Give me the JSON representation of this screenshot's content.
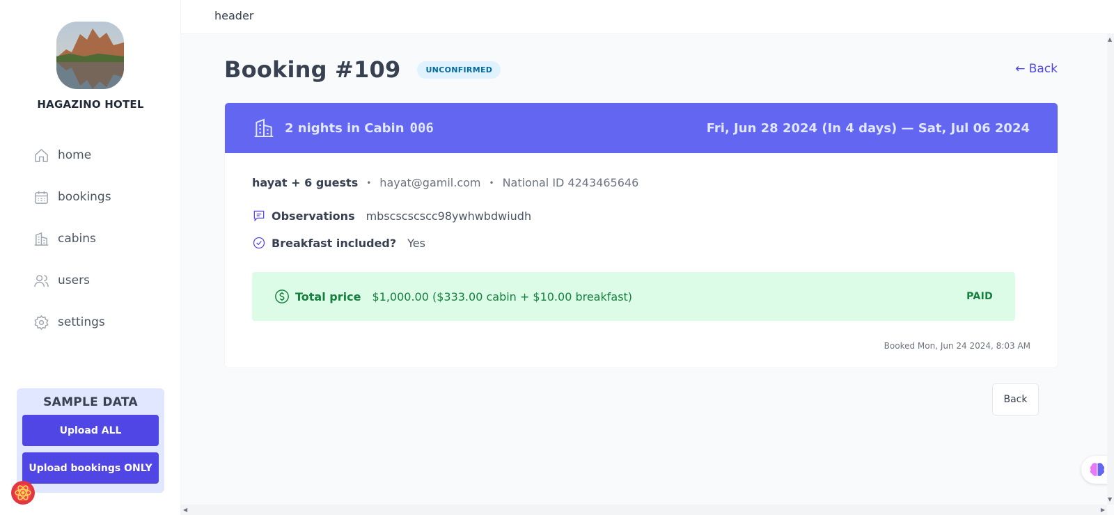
{
  "sidebar": {
    "logo_name": "HAGAZINO HOTEL",
    "nav": [
      {
        "label": "home",
        "icon": "home-icon"
      },
      {
        "label": "bookings",
        "icon": "calendar-icon"
      },
      {
        "label": "cabins",
        "icon": "building-icon"
      },
      {
        "label": "users",
        "icon": "users-icon"
      },
      {
        "label": "settings",
        "icon": "gear-icon"
      }
    ],
    "sample": {
      "title": "SAMPLE DATA",
      "upload_all": "Upload ALL",
      "upload_bookings": "Upload bookings ONLY"
    }
  },
  "header": {
    "text": "header"
  },
  "booking": {
    "title": "Booking #109",
    "status": "UNCONFIRMED",
    "back_link": "← Back",
    "nights": "2 nights in Cabin",
    "cabin_number": "006",
    "dates": "Fri, Jun 28 2024 (In 4 days) — Sat, Jul 06 2024",
    "guest_name": "hayat + 6 guests",
    "email": "hayat@gamil.com",
    "national_id": "National ID 4243465646",
    "observations_label": "Observations",
    "observations_value": "mbscscscscc98ywhwbdwiudh",
    "breakfast_label": "Breakfast included?",
    "breakfast_value": "Yes",
    "price_label": "Total price",
    "price_value": "$1,000.00 ($333.00 cabin + $10.00 breakfast)",
    "paid_status": "PAID",
    "booked_at": "Booked Mon, Jun 24 2024, 8:03 AM",
    "back_button": "Back"
  },
  "colors": {
    "brand": "#4f46e5",
    "card_header": "#6366f1",
    "paid_bg": "#dcfce7",
    "paid_text": "#15803d",
    "status_bg": "#e0f2fe",
    "status_text": "#0369a1"
  }
}
